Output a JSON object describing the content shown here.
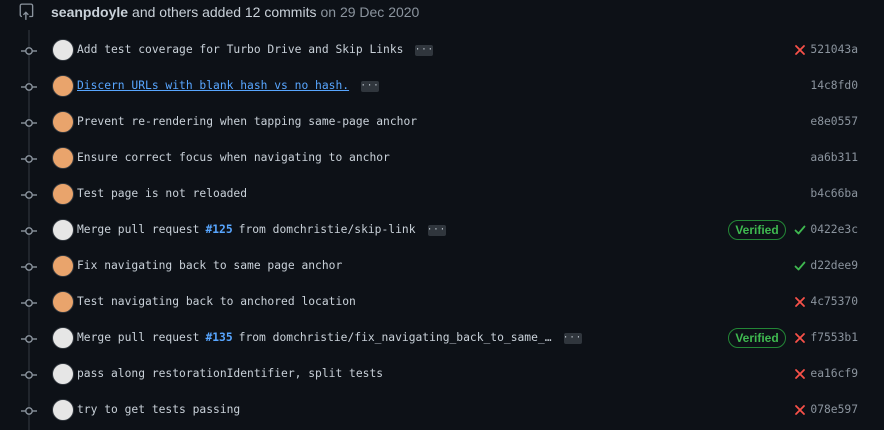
{
  "header": {
    "actor": "seanpdoyle",
    "action": "and others added 12 commits",
    "date": "on 29 Dec 2020"
  },
  "colors": {
    "success": "#3fb950",
    "failure": "#f85149",
    "link": "#58a6ff"
  },
  "commits": [
    {
      "message": "Add test coverage for Turbo Drive and Skip Links",
      "ellipsis": "…",
      "status": "failure",
      "sha": "521043a",
      "verified": "",
      "avatar": "grey"
    },
    {
      "message": "Discern URLs with blank hash vs no hash.",
      "ellipsis": "…",
      "status": "none",
      "sha": "14c8fd0",
      "verified": "",
      "avatar": "orange",
      "is_link": true
    },
    {
      "message": "Prevent re-rendering when tapping same-page anchor",
      "status": "none",
      "sha": "e8e0557",
      "verified": "",
      "avatar": "orange"
    },
    {
      "message": "Ensure correct focus when navigating to anchor",
      "status": "none",
      "sha": "aa6b311",
      "verified": "",
      "avatar": "orange"
    },
    {
      "message": "Test page is not reloaded",
      "status": "none",
      "sha": "b4c66ba",
      "verified": "",
      "avatar": "orange"
    },
    {
      "message_before": "Merge pull request",
      "pr": "#125",
      "message_after": "from domchristie/skip-link",
      "ellipsis": "…",
      "status": "success",
      "sha": "0422e3c",
      "verified": "Verified",
      "avatar": "grey"
    },
    {
      "message": "Fix navigating back to same page anchor",
      "status": "success",
      "sha": "d22dee9",
      "verified": "",
      "avatar": "orange"
    },
    {
      "message": "Test navigating back to anchored location",
      "status": "failure",
      "sha": "4c75370",
      "verified": "",
      "avatar": "orange"
    },
    {
      "message_before": "Merge pull request",
      "pr": "#135",
      "message_after": "from domchristie/fix_navigating_back_to_same_…",
      "ellipsis": "…",
      "status": "failure",
      "sha": "f7553b1",
      "verified": "Verified",
      "avatar": "grey"
    },
    {
      "message": "pass along restorationIdentifier, split tests",
      "status": "failure",
      "sha": "ea16cf9",
      "verified": "",
      "avatar": "grey"
    },
    {
      "message": "try to get tests passing",
      "status": "failure",
      "sha": "078e597",
      "verified": "",
      "avatar": "grey"
    }
  ]
}
